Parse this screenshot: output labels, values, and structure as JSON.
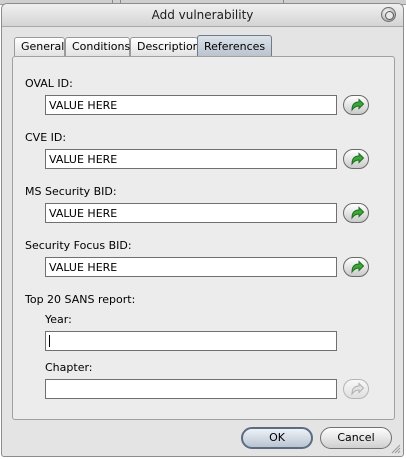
{
  "window": {
    "title": "Add vulnerability"
  },
  "tabs": [
    {
      "label": "General"
    },
    {
      "label": "Conditions"
    },
    {
      "label": "Description"
    },
    {
      "label": "References",
      "active": true
    }
  ],
  "fields": {
    "oval": {
      "label": "OVAL ID:",
      "value": "VALUE HERE"
    },
    "cve": {
      "label": "CVE ID:",
      "value": "VALUE HERE"
    },
    "ms": {
      "label": "MS Security BID:",
      "value": "VALUE HERE"
    },
    "sf": {
      "label": "Security Focus BID:",
      "value": "VALUE HERE"
    }
  },
  "sans": {
    "label": "Top 20 SANS report:",
    "year": {
      "label": "Year:",
      "value": ""
    },
    "chapter": {
      "label": "Chapter:",
      "value": ""
    }
  },
  "buttons": {
    "ok": "OK",
    "cancel": "Cancel"
  },
  "icons": {
    "go": "green-arrow-icon",
    "close": "close-icon"
  },
  "colors": {
    "arrow": "#2e9a2e",
    "active_tab": "#c5ced8"
  }
}
